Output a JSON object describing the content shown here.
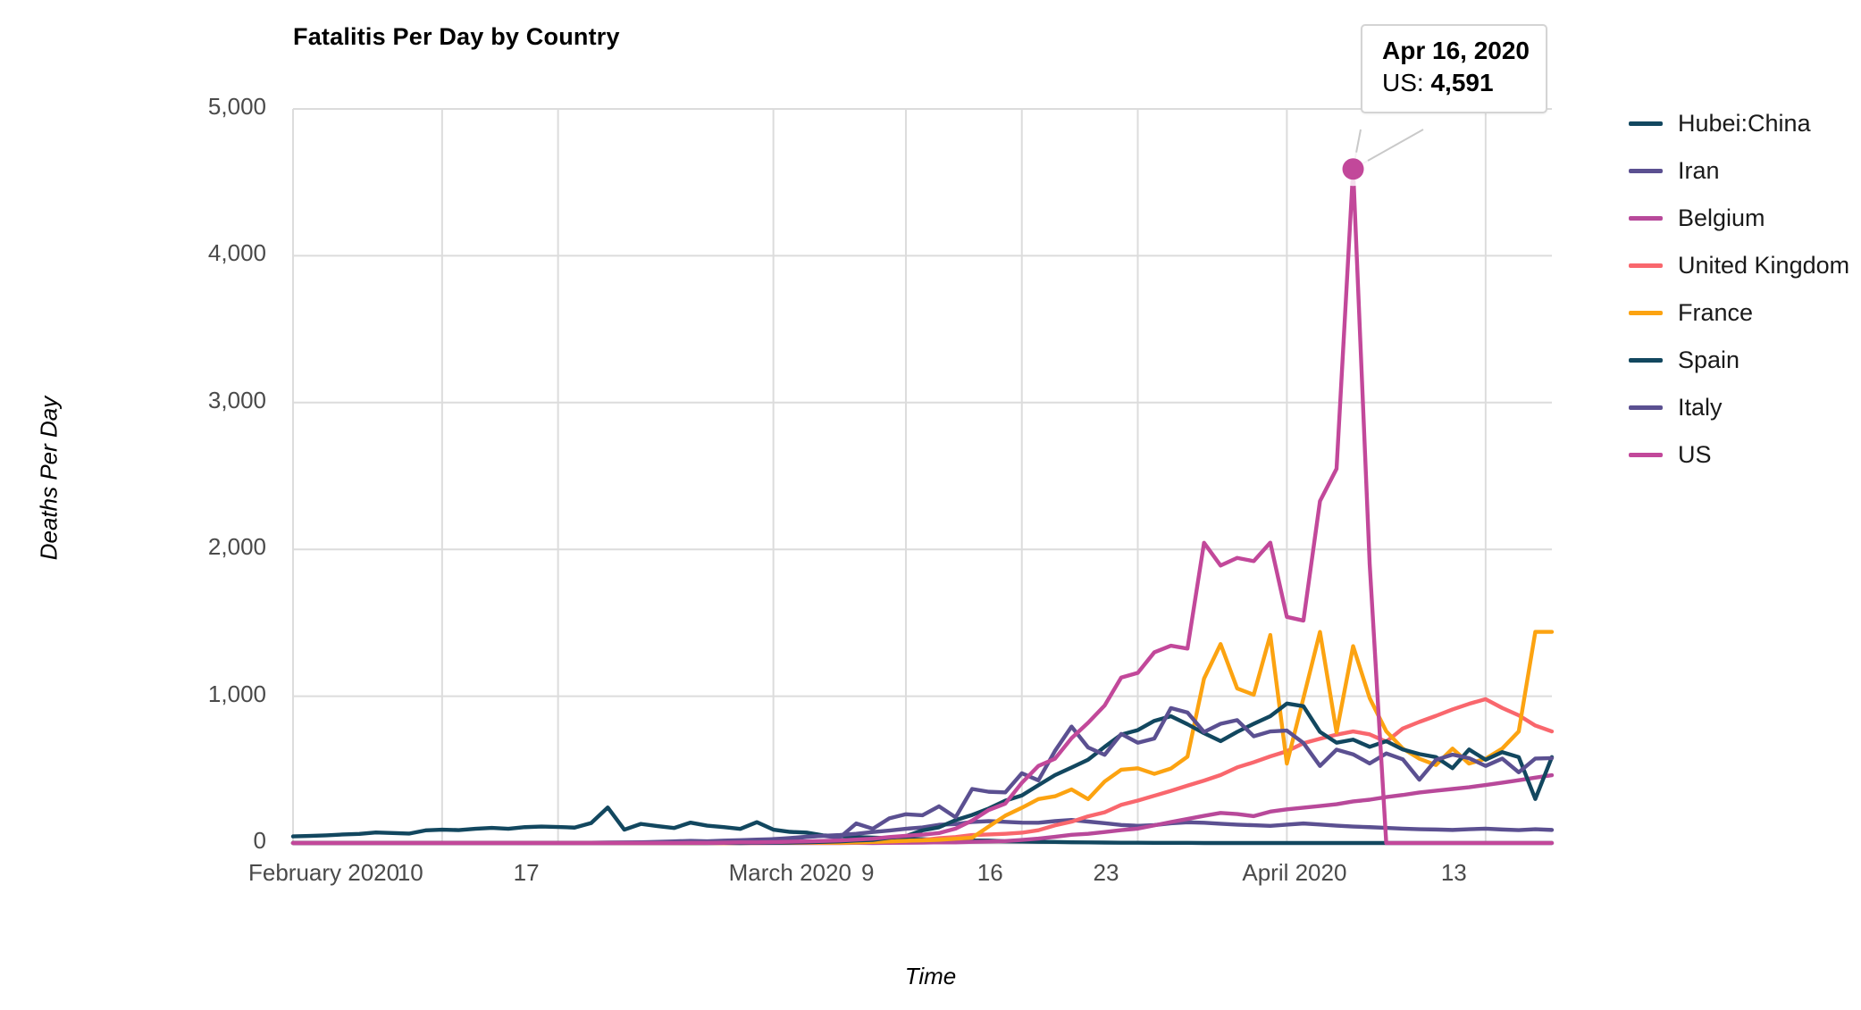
{
  "chart_data": {
    "type": "line",
    "title": "Fatalitis Per Day by Country",
    "xlabel": "Time",
    "ylabel": "Deaths Per Day",
    "ylim": [
      0,
      5000
    ],
    "ytick_labels": [
      "5,000",
      "4,000",
      "3,000",
      "2,000",
      "1,000",
      "0"
    ],
    "ytick_values": [
      5000,
      4000,
      3000,
      2000,
      1000,
      0
    ],
    "xtick_labels": [
      "February 2020",
      "10",
      "17",
      "March 2020",
      "9",
      "16",
      "23",
      "April 2020",
      "13"
    ],
    "xtick_index": [
      0,
      9,
      16,
      29,
      37,
      44,
      51,
      60,
      72
    ],
    "x_start": "2020-02-01",
    "x_end": "2020-04-17",
    "n_points": 77,
    "grid": true,
    "legend_position": "right",
    "legend": [
      "Hubei:China",
      "Iran",
      "Belgium",
      "United Kingdom",
      "France",
      "Spain",
      "Italy",
      "US"
    ],
    "colors": {
      "Hubei:China": "#12475f",
      "Iran": "#5b5091",
      "Belgium": "#b8499a",
      "United Kingdom": "#f9676d",
      "France": "#fca311",
      "Spain": "#12475f",
      "Italy": "#5b5091",
      "US": "#c2489a"
    },
    "series": [
      {
        "name": "Hubei:China",
        "color": "#12475f",
        "values": [
          45,
          48,
          52,
          58,
          62,
          72,
          68,
          64,
          86,
          91,
          88,
          97,
          103,
          97,
          108,
          112,
          109,
          105,
          136,
          242,
          91,
          130,
          115,
          102,
          139,
          118,
          108,
          96,
          142,
          91,
          76,
          71,
          52,
          47,
          41,
          37,
          33,
          29,
          26,
          21,
          18,
          17,
          16,
          12,
          10,
          8,
          7,
          5,
          4,
          3,
          2,
          2,
          1,
          1,
          1,
          0,
          0,
          0,
          0,
          0,
          0,
          0,
          0,
          0,
          0,
          0,
          0,
          0,
          0,
          0,
          0,
          0,
          0,
          0,
          0,
          0,
          0
        ]
      },
      {
        "name": "Iran",
        "color": "#5b5091",
        "values": [
          0,
          0,
          0,
          0,
          0,
          0,
          0,
          0,
          0,
          0,
          0,
          0,
          0,
          0,
          0,
          0,
          0,
          0,
          2,
          3,
          4,
          5,
          8,
          11,
          15,
          12,
          16,
          19,
          23,
          26,
          34,
          43,
          49,
          54,
          63,
          75,
          85,
          97,
          106,
          124,
          129,
          143,
          149,
          144,
          139,
          138,
          149,
          157,
          146,
          135,
          123,
          117,
          122,
          134,
          141,
          138,
          131,
          125,
          121,
          117,
          125,
          133,
          126,
          118,
          112,
          108,
          103,
          98,
          94,
          92,
          89,
          94,
          98,
          92,
          88,
          94,
          89
        ]
      },
      {
        "name": "Belgium",
        "color": "#b8499a",
        "values": [
          0,
          0,
          0,
          0,
          0,
          0,
          0,
          0,
          0,
          0,
          0,
          0,
          0,
          0,
          0,
          0,
          0,
          0,
          0,
          0,
          0,
          0,
          0,
          0,
          0,
          0,
          0,
          0,
          0,
          0,
          0,
          0,
          0,
          0,
          1,
          0,
          1,
          2,
          3,
          5,
          4,
          8,
          10,
          13,
          21,
          30,
          42,
          56,
          63,
          75,
          88,
          98,
          120,
          143,
          164,
          185,
          205,
          197,
          183,
          214,
          229,
          241,
          252,
          264,
          283,
          295,
          313,
          327,
          344,
          356,
          368,
          380,
          395,
          411,
          428,
          445,
          462
        ]
      },
      {
        "name": "United Kingdom",
        "color": "#f9676d",
        "values": [
          0,
          0,
          0,
          0,
          0,
          0,
          0,
          0,
          0,
          0,
          0,
          0,
          0,
          0,
          0,
          0,
          0,
          0,
          0,
          0,
          0,
          0,
          0,
          0,
          0,
          0,
          0,
          0,
          0,
          1,
          1,
          2,
          1,
          2,
          5,
          8,
          10,
          14,
          20,
          33,
          41,
          54,
          58,
          63,
          70,
          87,
          120,
          145,
          182,
          209,
          260,
          289,
          322,
          355,
          391,
          425,
          463,
          515,
          550,
          590,
          625,
          680,
          710,
          738,
          760,
          740,
          690,
          780,
          825,
          866,
          910,
          948,
          980,
          920,
          870,
          800,
          760
        ]
      },
      {
        "name": "France",
        "color": "#fca311",
        "values": [
          0,
          0,
          0,
          0,
          0,
          0,
          0,
          0,
          0,
          0,
          0,
          0,
          0,
          0,
          1,
          0,
          0,
          0,
          0,
          0,
          0,
          0,
          0,
          0,
          0,
          1,
          0,
          1,
          2,
          1,
          2,
          3,
          3,
          2,
          4,
          7,
          11,
          15,
          18,
          22,
          29,
          36,
          112,
          186,
          240,
          299,
          318,
          365,
          299,
          419,
          499,
          509,
          471,
          507,
          588,
          1120,
          1355,
          1053,
          1010,
          1417,
          541,
          987,
          1438,
          753,
          1341,
          987,
          761,
          643,
          574,
          531,
          643,
          541,
          574,
          643,
          760,
          1438,
          1438
        ]
      },
      {
        "name": "Spain",
        "color": "#12475f",
        "values": [
          0,
          0,
          0,
          0,
          0,
          0,
          0,
          0,
          0,
          0,
          0,
          0,
          0,
          0,
          0,
          0,
          0,
          0,
          0,
          0,
          0,
          0,
          0,
          0,
          0,
          0,
          1,
          0,
          2,
          1,
          3,
          5,
          8,
          11,
          17,
          21,
          36,
          47,
          86,
          107,
          156,
          191,
          235,
          288,
          324,
          394,
          462,
          514,
          567,
          655,
          738,
          769,
          832,
          864,
          809,
          748,
          694,
          757,
          812,
          864,
          950,
          932,
          757,
          683,
          704,
          655,
          694,
          637,
          606,
          585,
          510,
          637,
          567,
          619,
          585,
          300,
          585
        ]
      },
      {
        "name": "Italy",
        "color": "#5b5091",
        "values": [
          0,
          0,
          0,
          0,
          0,
          0,
          0,
          0,
          0,
          0,
          0,
          0,
          0,
          0,
          0,
          0,
          0,
          0,
          0,
          0,
          1,
          2,
          3,
          5,
          8,
          4,
          8,
          12,
          11,
          27,
          28,
          41,
          49,
          36,
          133,
          97,
          168,
          196,
          189,
          250,
          175,
          368,
          349,
          345,
          475,
          427,
          627,
          793,
          651,
          601,
          743,
          683,
          712,
          919,
          889,
          756,
          812,
          837,
          727,
          760,
          766,
          681,
          525,
          636,
          604,
          542,
          610,
          570,
          431,
          566,
          602,
          578,
          525,
          575,
          482,
          575,
          578
        ]
      },
      {
        "name": "US",
        "color": "#c2489a",
        "values": [
          0,
          0,
          0,
          0,
          0,
          0,
          0,
          0,
          0,
          0,
          0,
          0,
          0,
          0,
          0,
          0,
          0,
          0,
          0,
          0,
          0,
          0,
          0,
          0,
          1,
          1,
          2,
          4,
          4,
          6,
          9,
          11,
          14,
          17,
          23,
          29,
          41,
          49,
          57,
          68,
          98,
          153,
          225,
          268,
          410,
          525,
          574,
          714,
          819,
          937,
          1127,
          1159,
          1299,
          1344,
          1324,
          2045,
          1890,
          1942,
          1920,
          2046,
          1540,
          1515,
          2329,
          2549,
          4591,
          1900,
          0,
          0,
          0,
          0,
          0,
          0,
          0,
          0,
          0,
          0,
          0
        ]
      }
    ],
    "annotation": {
      "date": "Apr 16, 2020",
      "series": "US",
      "label": "US:",
      "value": "4,591",
      "point_index": 64
    }
  }
}
